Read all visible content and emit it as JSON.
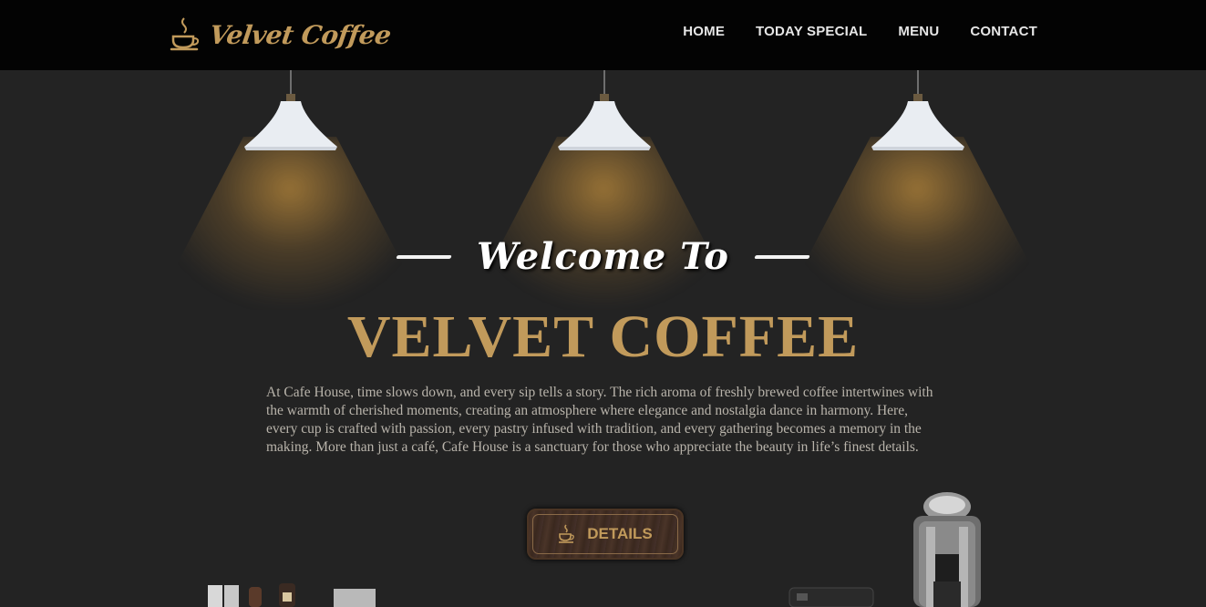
{
  "brand": {
    "name": "Velvet Coffee",
    "icon": "coffee-cup-icon",
    "color": "#c19a5b"
  },
  "nav": [
    {
      "label": "HOME"
    },
    {
      "label": "TODAY SPECIAL"
    },
    {
      "label": "MENU"
    },
    {
      "label": "CONTACT"
    }
  ],
  "hero": {
    "welcome": "Welcome To",
    "title": "VELVET COFFEE",
    "description": "At Cafe House, time slows down, and every sip tells a story. The rich aroma of freshly brewed coffee intertwines with the warmth of cherished moments, creating an atmosphere where elegance and nostalgia dance in harmony. Here, every cup is crafted with passion, every pastry infused with tradition, and every gathering becomes a memory in the making. More than just a café, Cafe House is a sanctuary for those who appreciate the beauty in life’s finest details.",
    "button": {
      "label": "DETAILS",
      "icon": "coffee-cup-icon"
    }
  },
  "colors": {
    "accent": "#c19a5b",
    "background": "#232323",
    "header": "#030303"
  }
}
